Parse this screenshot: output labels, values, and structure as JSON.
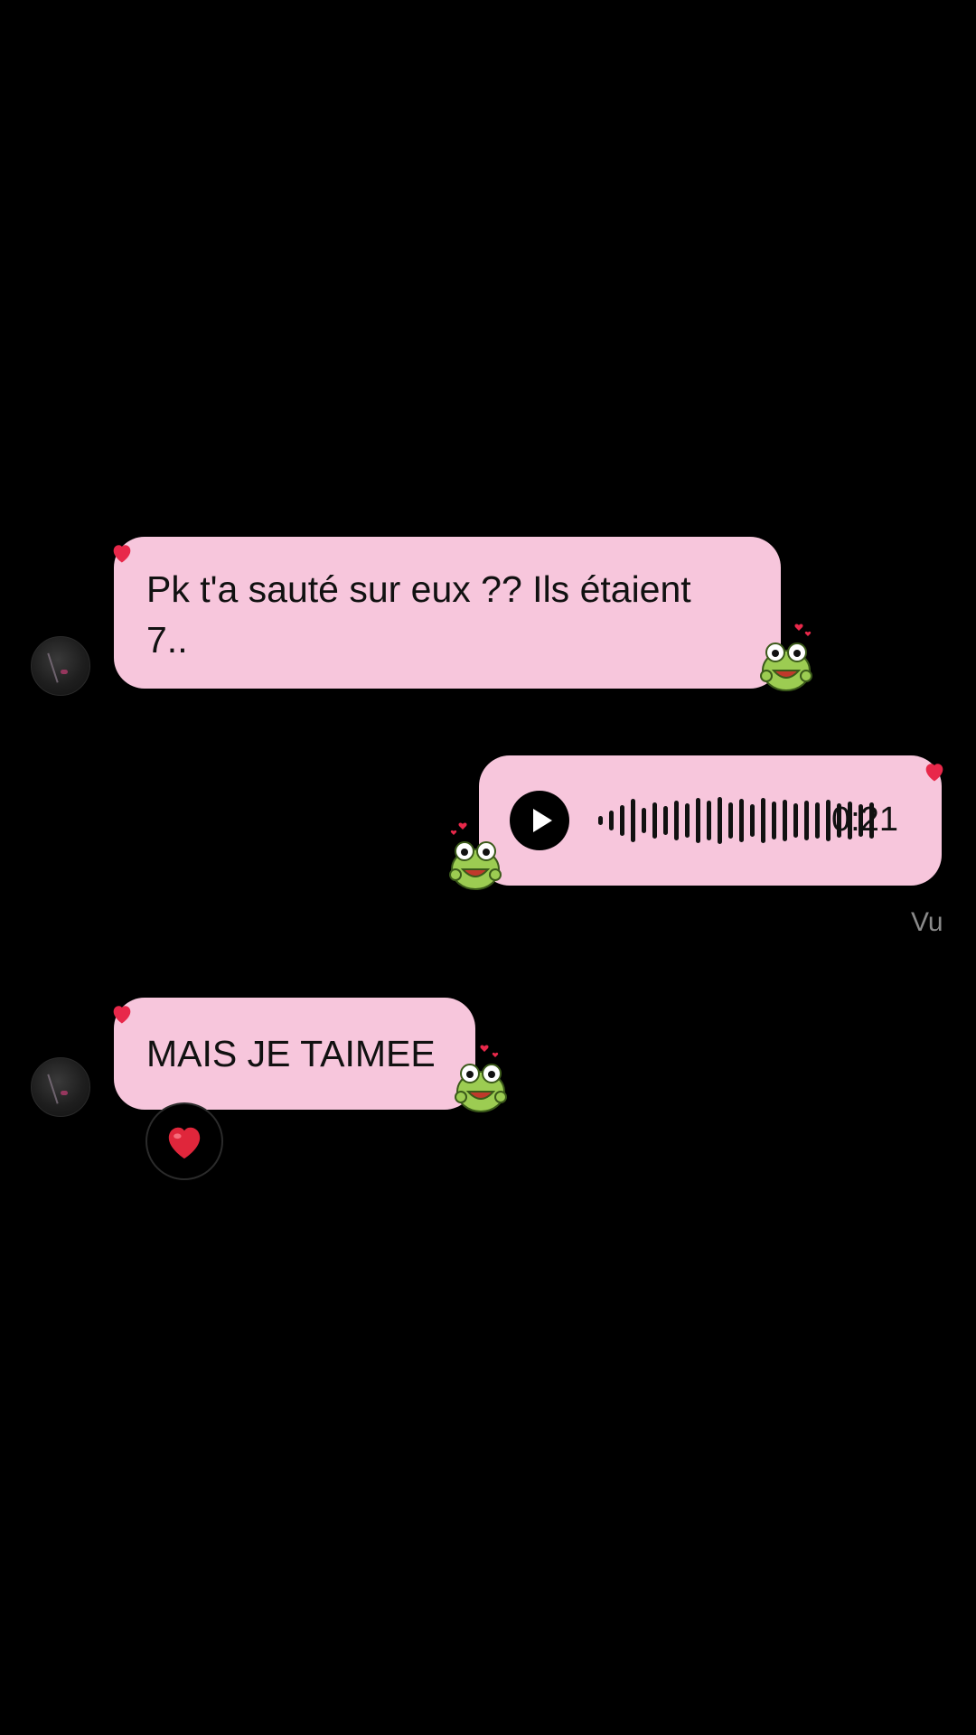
{
  "messages": [
    {
      "type": "received",
      "text": "Pk t'a sauté sur eux ?? Ils étaient 7..",
      "line1": "Pk t'a sauté sur eux ?? Ils étaient",
      "line2": "7.."
    },
    {
      "type": "sent_voice",
      "duration": "0:21"
    },
    {
      "type": "received",
      "text": "MAIS JE TAIMEE",
      "reaction": "heart-emoji"
    }
  ],
  "status": {
    "seen": "Vu"
  },
  "colors": {
    "background": "#000000",
    "bubble": "#f7c6dc",
    "accent_heart": "#e8284a",
    "text": "#111111",
    "seen": "#8a8a8a"
  },
  "icons": [
    "play-icon",
    "heart-icon",
    "frog-sticker-icon",
    "avatar"
  ]
}
